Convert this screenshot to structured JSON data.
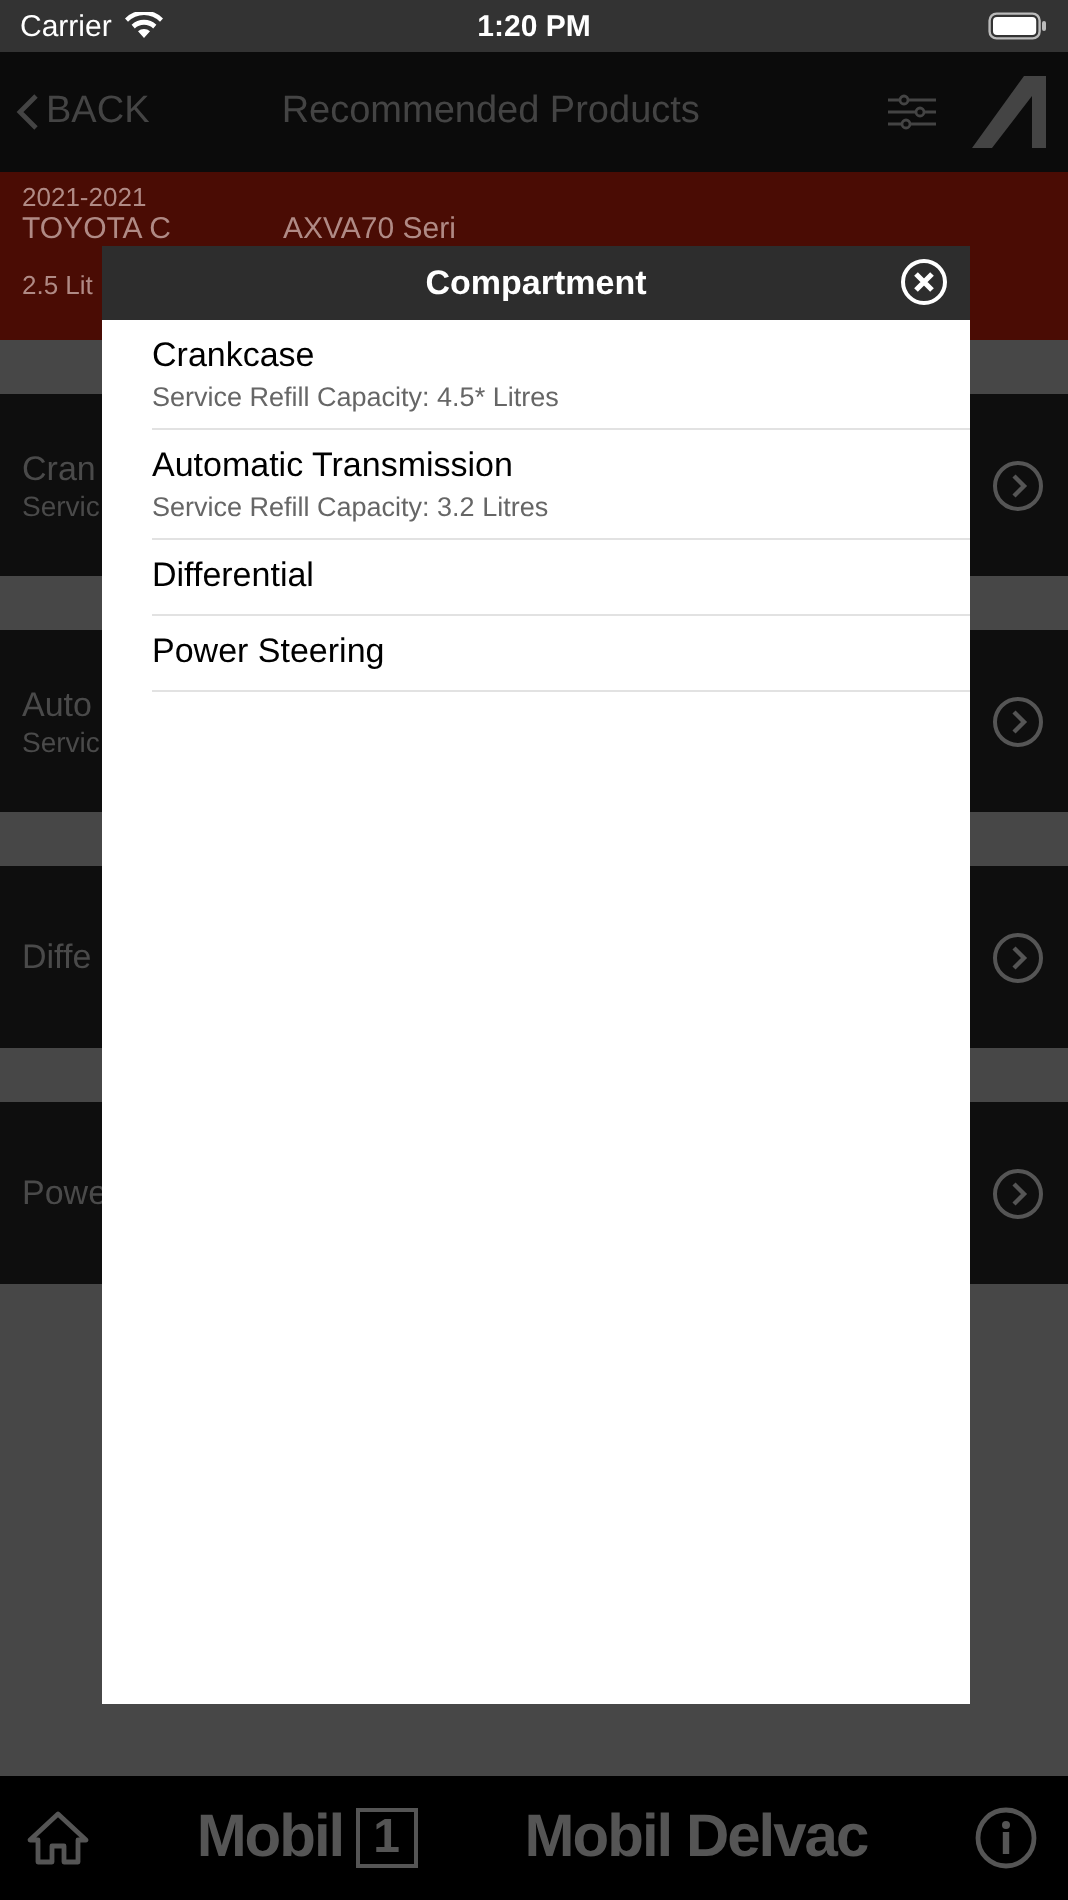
{
  "status_bar": {
    "carrier": "Carrier",
    "time": "1:20 PM"
  },
  "nav_bar": {
    "back": "BACK",
    "title": "Recommended Products"
  },
  "vehicle": {
    "years": "2021-2021",
    "model_parts": [
      "TOYOTA C",
      "AXVA70 Seri"
    ],
    "engine": "2.5 Lit"
  },
  "background_rows": [
    {
      "title": "Cran",
      "subtitle": "Servic"
    },
    {
      "title": "Auto",
      "subtitle": "Servic"
    },
    {
      "title": "Diffe"
    },
    {
      "title": "Powe"
    }
  ],
  "modal": {
    "title": "Compartment",
    "items": [
      {
        "title": "Crankcase",
        "subtitle": "Service Refill Capacity: 4.5* Litres"
      },
      {
        "title": "Automatic Transmission",
        "subtitle": "Service Refill Capacity: 3.2 Litres"
      },
      {
        "title": "Differential"
      },
      {
        "title": "Power Steering"
      }
    ]
  },
  "tab_bar": {
    "logos": [
      {
        "kind": "boxed",
        "name": "Mobil",
        "badge": "1"
      },
      {
        "kind": "plain",
        "name": "Mobil Delvac"
      }
    ]
  }
}
